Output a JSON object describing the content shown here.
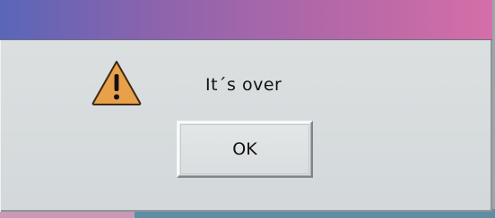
{
  "dialog": {
    "icon": "warning-icon",
    "message": "It´s over",
    "ok_label": "OK"
  },
  "colors": {
    "titlebar_gradient_start": "#5a66b8",
    "titlebar_gradient_end": "#d56ea8",
    "warning_fill": "#e8a04a",
    "dialog_background": "#d9dddf"
  }
}
